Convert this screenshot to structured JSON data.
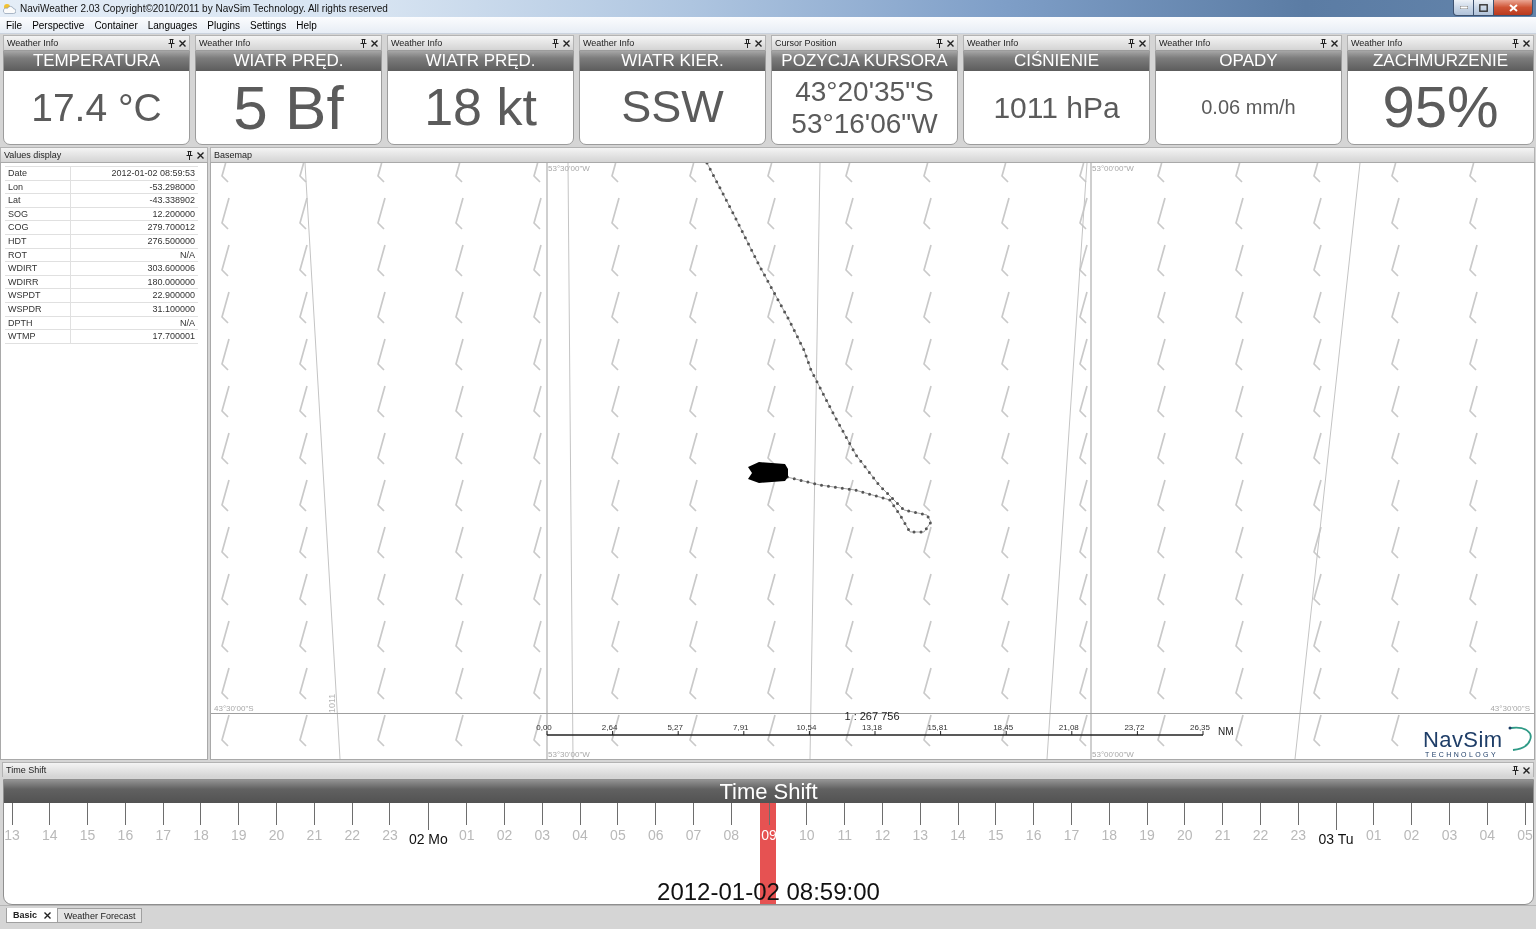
{
  "window": {
    "title": "NaviWeather 2.03 Copyright©2010/2011 by NavSim Technology. All rights reserved"
  },
  "menu": [
    "File",
    "Perspective",
    "Container",
    "Languages",
    "Plugins",
    "Settings",
    "Help"
  ],
  "widgets": [
    {
      "panel_title": "Weather Info",
      "heading": "TEMPERATURA",
      "value_lines": [
        "17.4 °C"
      ]
    },
    {
      "panel_title": "Weather Info",
      "heading": "WIATR PRĘD.",
      "value_lines": [
        "5 Bf"
      ]
    },
    {
      "panel_title": "Weather Info",
      "heading": "WIATR PRĘD.",
      "value_lines": [
        "18 kt"
      ]
    },
    {
      "panel_title": "Weather Info",
      "heading": "WIATR KIER.",
      "value_lines": [
        "SSW"
      ]
    },
    {
      "panel_title": "Cursor Position",
      "heading": "POZYCJA KURSORA",
      "value_lines": [
        "43°20'35\"S",
        "53°16'06\"W"
      ]
    },
    {
      "panel_title": "Weather Info",
      "heading": "CIŚNIENIE",
      "value_lines": [
        "1011 hPa"
      ]
    },
    {
      "panel_title": "Weather Info",
      "heading": "OPADY",
      "value_lines": [
        "0.06 mm/h"
      ]
    },
    {
      "panel_title": "Weather Info",
      "heading": "ZACHMURZENIE",
      "value_lines": [
        "95%"
      ]
    }
  ],
  "values_display": {
    "title": "Values display",
    "rows": [
      {
        "name": "Date",
        "value": "2012-01-02 08:59:53"
      },
      {
        "name": "Lon",
        "value": "-53.298000"
      },
      {
        "name": "Lat",
        "value": "-43.338902"
      },
      {
        "name": "SOG",
        "value": "12.200000"
      },
      {
        "name": "COG",
        "value": "279.700012"
      },
      {
        "name": "HDT",
        "value": "276.500000"
      },
      {
        "name": "ROT",
        "value": "N/A"
      },
      {
        "name": "WDIRT",
        "value": "303.600006"
      },
      {
        "name": "WDIRR",
        "value": "180.000000"
      },
      {
        "name": "WSPDT",
        "value": "22.900000"
      },
      {
        "name": "WSPDR",
        "value": "31.100000"
      },
      {
        "name": "DPTH",
        "value": "N/A"
      },
      {
        "name": "WTMP",
        "value": "17.700001"
      }
    ]
  },
  "basemap": {
    "title": "Basemap",
    "latitude_labels": [
      "43°30'00\"S",
      "43°30'00\"S"
    ],
    "longitude_labels_top": [
      "53°30'00\"W",
      "53°00'00\"W"
    ],
    "longitude_labels_bottom": [
      "53°30'00\"W",
      "53°00'00\"W"
    ],
    "isobar_label": "1011",
    "scale": {
      "ratio": "1 : 267 756",
      "ticks": [
        "0,00",
        "2,64",
        "5,27",
        "7,91",
        "10,54",
        "13,18",
        "15,81",
        "18,45",
        "21,08",
        "23,72",
        "26,35"
      ],
      "unit": "NM"
    },
    "logo": {
      "name": "NavSim",
      "tagline": "TECHNOLOGY"
    }
  },
  "time_shift": {
    "title": "Time Shift",
    "heading": "Time Shift",
    "ticks": [
      {
        "label": "13",
        "kind": "hour"
      },
      {
        "label": "14",
        "kind": "hour"
      },
      {
        "label": "15",
        "kind": "hour"
      },
      {
        "label": "16",
        "kind": "hour"
      },
      {
        "label": "17",
        "kind": "hour"
      },
      {
        "label": "18",
        "kind": "hour"
      },
      {
        "label": "19",
        "kind": "hour"
      },
      {
        "label": "20",
        "kind": "hour"
      },
      {
        "label": "21",
        "kind": "hour"
      },
      {
        "label": "22",
        "kind": "hour"
      },
      {
        "label": "23",
        "kind": "hour"
      },
      {
        "label": "02 Mo",
        "kind": "day"
      },
      {
        "label": "01",
        "kind": "hour"
      },
      {
        "label": "02",
        "kind": "hour"
      },
      {
        "label": "03",
        "kind": "hour"
      },
      {
        "label": "04",
        "kind": "hour"
      },
      {
        "label": "05",
        "kind": "hour"
      },
      {
        "label": "06",
        "kind": "hour"
      },
      {
        "label": "07",
        "kind": "hour"
      },
      {
        "label": "08",
        "kind": "hour"
      },
      {
        "label": "09",
        "kind": "hour"
      },
      {
        "label": "10",
        "kind": "hour"
      },
      {
        "label": "11",
        "kind": "hour"
      },
      {
        "label": "12",
        "kind": "hour"
      },
      {
        "label": "13",
        "kind": "hour"
      },
      {
        "label": "14",
        "kind": "hour"
      },
      {
        "label": "15",
        "kind": "hour"
      },
      {
        "label": "16",
        "kind": "hour"
      },
      {
        "label": "17",
        "kind": "hour"
      },
      {
        "label": "18",
        "kind": "hour"
      },
      {
        "label": "19",
        "kind": "hour"
      },
      {
        "label": "20",
        "kind": "hour"
      },
      {
        "label": "21",
        "kind": "hour"
      },
      {
        "label": "22",
        "kind": "hour"
      },
      {
        "label": "23",
        "kind": "hour"
      },
      {
        "label": "03 Tu",
        "kind": "day"
      },
      {
        "label": "01",
        "kind": "hour"
      },
      {
        "label": "02",
        "kind": "hour"
      },
      {
        "label": "03",
        "kind": "hour"
      },
      {
        "label": "04",
        "kind": "hour"
      },
      {
        "label": "05",
        "kind": "hour"
      }
    ],
    "level": 0.5,
    "current": "2012-01-02 08:59:00"
  },
  "bottom_tabs": [
    {
      "label": "Basic",
      "selected": true
    },
    {
      "label": "Weather Forecast",
      "selected": false
    }
  ]
}
